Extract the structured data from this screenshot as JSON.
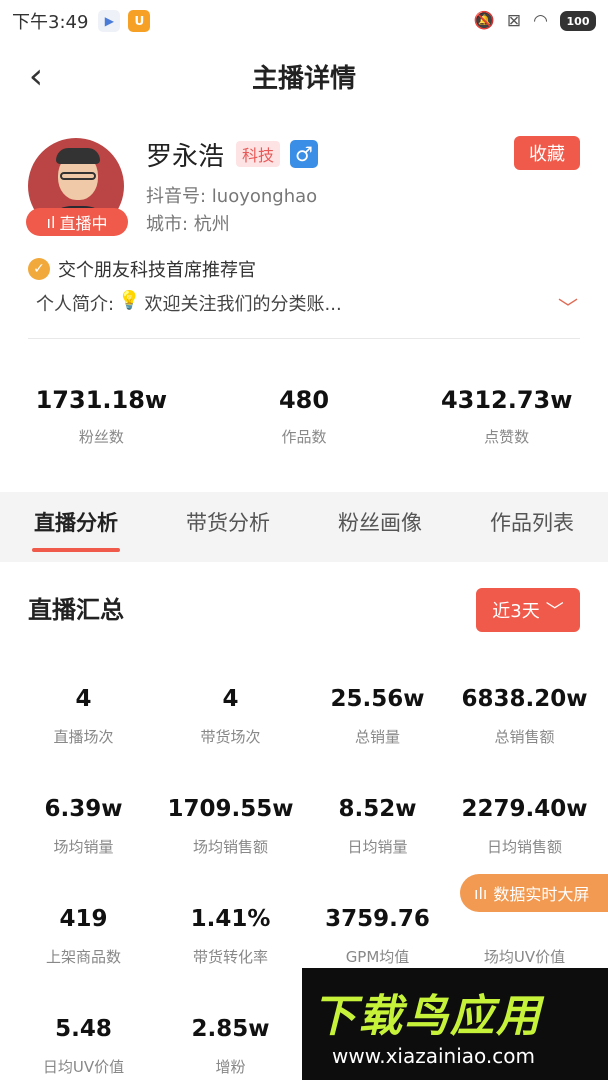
{
  "status_bar": {
    "time": "下午3:49",
    "battery": "100"
  },
  "header": {
    "title": "主播详情"
  },
  "profile": {
    "name": "罗永浩",
    "category_tag": "科技",
    "gender_symbol": "♂",
    "collect_label": "收藏",
    "douyin_id": "抖音号: luoyonghao",
    "city": "城市: 杭州",
    "live_badge": "直播中",
    "verification": "交个朋友科技首席推荐官",
    "bio_label": "个人简介:",
    "bio_text": "欢迎关注我们的分类账..."
  },
  "stats": [
    {
      "value": "1731.18w",
      "label": "粉丝数"
    },
    {
      "value": "480",
      "label": "作品数"
    },
    {
      "value": "4312.73w",
      "label": "点赞数"
    }
  ],
  "tabs": [
    "直播分析",
    "带货分析",
    "粉丝画像",
    "作品列表"
  ],
  "summary": {
    "title": "直播汇总",
    "range_label": "近3天",
    "metrics": [
      {
        "value": "4",
        "label": "直播场次"
      },
      {
        "value": "4",
        "label": "带货场次"
      },
      {
        "value": "25.56w",
        "label": "总销量"
      },
      {
        "value": "6838.20w",
        "label": "总销售额"
      },
      {
        "value": "6.39w",
        "label": "场均销量"
      },
      {
        "value": "1709.55w",
        "label": "场均销售额"
      },
      {
        "value": "8.52w",
        "label": "日均销量"
      },
      {
        "value": "2279.40w",
        "label": "日均销售额"
      },
      {
        "value": "419",
        "label": "上架商品数"
      },
      {
        "value": "1.41%",
        "label": "带货转化率"
      },
      {
        "value": "3759.76",
        "label": "GPM均值"
      },
      {
        "value": "",
        "label": "场均UV价值"
      },
      {
        "value": "5.48",
        "label": "日均UV价值"
      },
      {
        "value": "2.85w",
        "label": "增粉"
      }
    ]
  },
  "float_button": "数据实时大屏",
  "watermark": {
    "title": "下载鸟应用",
    "url": "www.xiazainiao.com"
  }
}
